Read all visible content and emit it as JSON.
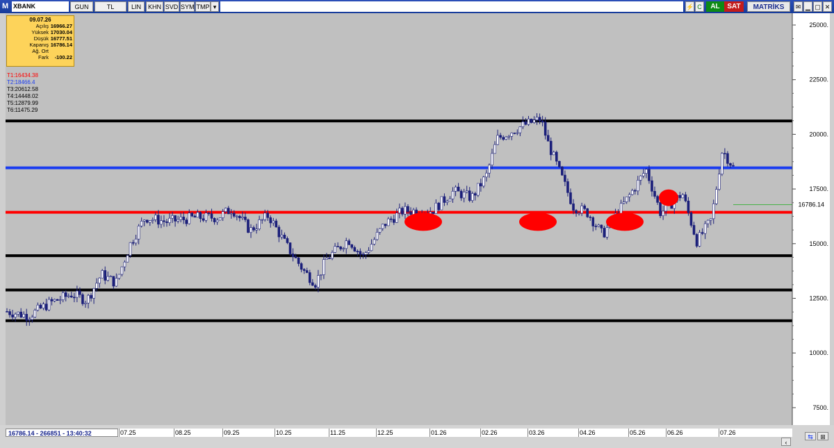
{
  "toolbar": {
    "logo": "M",
    "symbol": "XBANK",
    "buttons": [
      "GUN",
      "TL",
      "LIN",
      "KHN",
      "SVD",
      "SYM",
      "TMP"
    ],
    "al_label": "AL",
    "sat_label": "SAT",
    "matriks_label": "MATRİKS",
    "icons": [
      "bolt-icon",
      "refresh-icon",
      "mail-icon",
      "minimize-icon",
      "restore-icon",
      "close-icon"
    ]
  },
  "info": {
    "date": "09.07.26",
    "rows": [
      {
        "label": "Açılış",
        "value": "16966.27"
      },
      {
        "label": "Yüksek",
        "value": "17030.04"
      },
      {
        "label": "Düşük",
        "value": "16777.51"
      },
      {
        "label": "Kapanış",
        "value": "16786.14"
      },
      {
        "label": "Ağ. Ort",
        "value": ""
      },
      {
        "label": "Fark",
        "value": "-100.22"
      }
    ]
  },
  "status_text": "16786.14 - 266851 - 13:40:32",
  "colors": {
    "red_level": "#ff0000",
    "blue_level": "#1a3cf0",
    "black_level": "#000000",
    "candle": "#1b1f7a",
    "marker": "#ff0000"
  },
  "chart_data": {
    "type": "candlestick",
    "y_ticks": [
      25000,
      22500,
      20000,
      17500,
      15000,
      12500,
      10000,
      7500
    ],
    "y_tick_labels": [
      "25000.",
      "22500.",
      "20000.",
      "17500.",
      "15000.",
      "12500.",
      "10000.",
      "7500."
    ],
    "ylim": [
      6500,
      25500
    ],
    "x_tick_labels": [
      "07.25",
      "08.25",
      "09.25",
      "10.25",
      "11.25",
      "12.25",
      "01.26",
      "02.26",
      "03.26",
      "04.26",
      "05.26",
      "06.26",
      "07.26"
    ],
    "last_price": 16786.14,
    "last_price_label": "16786.14",
    "levels": [
      {
        "name": "T1",
        "label": "T1:16434.38",
        "value": 16434.38,
        "color": "#ff0000"
      },
      {
        "name": "T2",
        "label": "T2:18466.4",
        "value": 18466.4,
        "color": "#1a3cf0"
      },
      {
        "name": "T3",
        "label": "T3:20612.58",
        "value": 20612.58,
        "color": "#000000"
      },
      {
        "name": "T4",
        "label": "T4:14448.02",
        "value": 14448.02,
        "color": "#000000"
      },
      {
        "name": "T5",
        "label": "T5:12879.99",
        "value": 12879.99,
        "color": "#000000"
      },
      {
        "name": "T6",
        "label": "T6:11475.29",
        "value": 11475.29,
        "color": "#000000"
      }
    ],
    "price_path": [
      [
        0,
        11900
      ],
      [
        0.03,
        11700
      ],
      [
        0.06,
        12300
      ],
      [
        0.09,
        12700
      ],
      [
        0.11,
        12400
      ],
      [
        0.13,
        13600
      ],
      [
        0.15,
        13200
      ],
      [
        0.17,
        15000
      ],
      [
        0.19,
        16200
      ],
      [
        0.22,
        16000
      ],
      [
        0.26,
        16200
      ],
      [
        0.29,
        16200
      ],
      [
        0.31,
        16600
      ],
      [
        0.335,
        15600
      ],
      [
        0.36,
        16300
      ],
      [
        0.385,
        14900
      ],
      [
        0.41,
        13700
      ],
      [
        0.425,
        13200
      ],
      [
        0.44,
        14300
      ],
      [
        0.47,
        15200
      ],
      [
        0.49,
        14400
      ],
      [
        0.52,
        15900
      ],
      [
        0.545,
        16500
      ],
      [
        0.585,
        16500
      ],
      [
        0.615,
        17400
      ],
      [
        0.64,
        17100
      ],
      [
        0.66,
        18100
      ],
      [
        0.675,
        19800
      ],
      [
        0.71,
        20400
      ],
      [
        0.735,
        20700
      ],
      [
        0.745,
        19600
      ],
      [
        0.78,
        16700
      ],
      [
        0.8,
        16400
      ],
      [
        0.82,
        15400
      ],
      [
        0.845,
        16600
      ],
      [
        0.865,
        17600
      ],
      [
        0.88,
        18400
      ],
      [
        0.9,
        16400
      ],
      [
        0.93,
        17300
      ],
      [
        0.95,
        15100
      ],
      [
        0.97,
        16100
      ],
      [
        0.985,
        19300
      ],
      [
        1.0,
        18500
      ]
    ],
    "markers": [
      {
        "x_label": "01.26",
        "price": 16000,
        "size": "large"
      },
      {
        "x_label": "03.26",
        "price": 16000,
        "size": "large"
      },
      {
        "x_label": "05.26",
        "price": 16000,
        "size": "large"
      },
      {
        "x_label": "06.26",
        "price": 17100,
        "size": "small"
      }
    ]
  }
}
